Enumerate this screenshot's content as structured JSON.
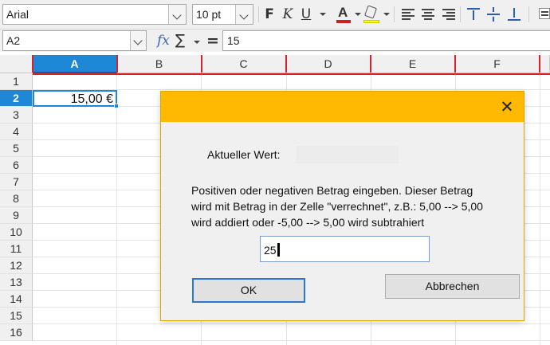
{
  "toolbar": {
    "font_name": "Arial",
    "font_size": "10 pt",
    "bold_label": "F",
    "italic_label": "K",
    "underline_label": "U",
    "font_color_label": "A",
    "font_color": "#c9211e",
    "highlight_color": "#ffff00",
    "icons": [
      "bold-icon",
      "italic-icon",
      "underline-icon",
      "font-color-icon",
      "highlight-icon",
      "align-left-icon",
      "align-center-icon",
      "align-right-icon",
      "align-top-icon",
      "align-middle-icon",
      "align-bottom-icon",
      "wrap-text-icon"
    ]
  },
  "formula_bar": {
    "name_box": "A2",
    "fx_label": "fx",
    "sum_label": "∑",
    "equals_label": "=",
    "content": "15"
  },
  "sheet": {
    "columns": [
      "A",
      "B",
      "C",
      "D",
      "E",
      "F"
    ],
    "active_column": "A",
    "rows": [
      "1",
      "2",
      "3",
      "4",
      "5",
      "6",
      "7",
      "8",
      "9",
      "10",
      "11",
      "12",
      "13",
      "14",
      "15",
      "16"
    ],
    "active_row": "2",
    "cell_a2": "15,00 €",
    "selection_color": "#1e87d6",
    "page_break_color": "#d8222a"
  },
  "dialog": {
    "title_bar_color": "#ffb900",
    "current_value_label": "Aktueller Wert:",
    "current_value": "",
    "description_lines": [
      "Positiven oder negativen Betrag eingeben. Dieser Betrag",
      "wird mit Betrag in der Zelle \"verrechnet\", z.B.: 5,00 --> 5,00",
      "wird addiert oder -5,00 --> 5,00 wird subtrahiert"
    ],
    "amount_value": "25",
    "ok_label": "OK",
    "cancel_label": "Abbrechen"
  }
}
